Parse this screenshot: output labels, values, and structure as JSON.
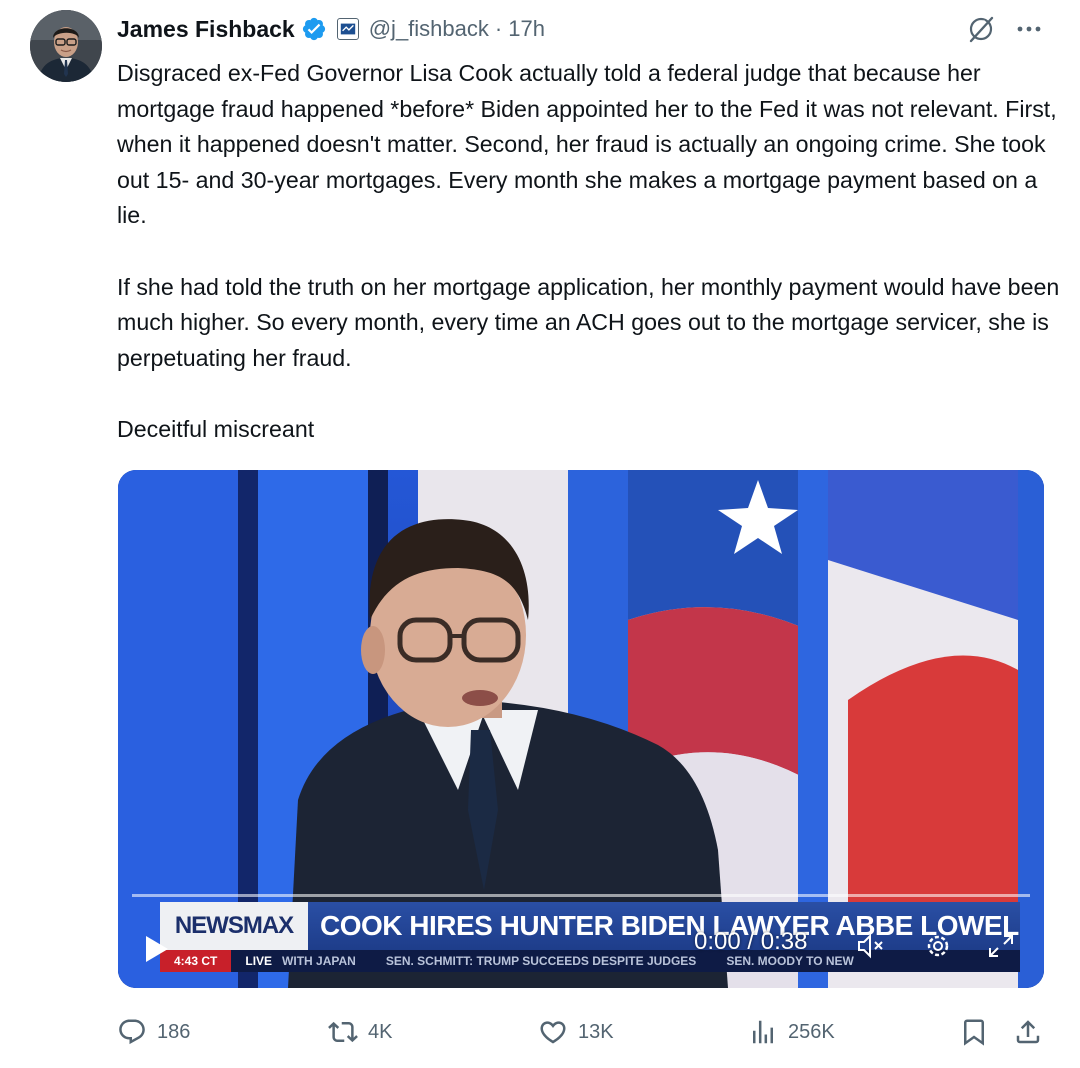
{
  "author": {
    "display_name": "James Fishback",
    "handle": "@j_fishback",
    "separator": "·",
    "timestamp": "17h",
    "verified": true,
    "verified_color": "#1d9bf0"
  },
  "tweet": {
    "paragraphs": [
      "Disgraced ex-Fed Governor Lisa Cook actually told a federal judge that because her mortgage fraud happened *before* Biden appointed her to the Fed it was not relevant. First, when it happened doesn't matter. Second, her fraud is actually an ongoing crime. She took out 15- and 30-year mortgages. Every month she makes a mortgage payment based on a lie.",
      "If she had told the truth on her mortgage application, her monthly payment would have been much higher. So every month, every time an ACH goes out to the mortgage servicer, she is perpetuating her fraud.",
      "Deceitful miscreant"
    ]
  },
  "video": {
    "broadcaster": "NEWSMAX",
    "headline": "COOK HIRES HUNTER BIDEN LAWYER ABBE LOWELL",
    "ticker": {
      "time": "4:43 CT",
      "live": "LIVE",
      "items": [
        "WITH JAPAN",
        "SEN. SCHMITT: TRUMP SUCCEEDS DESPITE JUDGES",
        "SEN. MOODY TO NEW"
      ]
    },
    "timecode": "0:00 / 0:38",
    "progress": 0,
    "muted": true
  },
  "actions": {
    "replies": "186",
    "reposts": "4K",
    "likes": "13K",
    "views": "256K"
  },
  "colors": {
    "text": "#0f1419",
    "secondary": "#536471",
    "accent": "#1d9bf0"
  }
}
